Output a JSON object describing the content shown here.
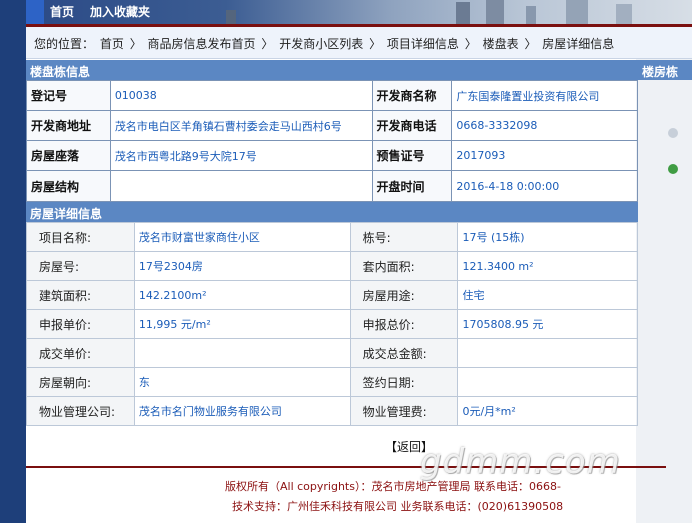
{
  "nav": {
    "home": "首页",
    "favorite": "加入收藏夹"
  },
  "breadcrumb": {
    "prefix": "您的位置：",
    "items": [
      "首页",
      "商品房信息发布首页",
      "开发商小区列表",
      "项目详细信息",
      "楼盘表",
      "房屋详细信息"
    ],
    "separator": "〉"
  },
  "building_info": {
    "header": "楼盘栋信息",
    "side_header": "楼房栋",
    "rows": [
      {
        "l1": "登记号",
        "v1": "010038",
        "l2": "开发商名称",
        "v2": "广东国泰隆置业投资有限公司"
      },
      {
        "l1": "开发商地址",
        "v1": "茂名市电白区羊角镇石曹村委会走马山西村6号",
        "l2": "开发商电话",
        "v2": "0668-3332098"
      },
      {
        "l1": "房屋座落",
        "v1": "茂名市西粤北路9号大院17号",
        "l2": "预售证号",
        "v2": "2017093"
      },
      {
        "l1": "房屋结构",
        "v1": "",
        "l2": "开盘时间",
        "v2": "2016-4-18 0:00:00"
      }
    ]
  },
  "house_detail": {
    "header": "房屋详细信息",
    "rows": [
      {
        "l1": "项目名称:",
        "v1": "茂名市财富世家商住小区",
        "l2": "栋号:",
        "v2": "17号 (15栋)"
      },
      {
        "l1": "房屋号:",
        "v1": "17号2304房",
        "l2": "套内面积:",
        "v2": "121.3400 m²"
      },
      {
        "l1": "建筑面积:",
        "v1": "142.2100m²",
        "l2": "房屋用途:",
        "v2": "住宅"
      },
      {
        "l1": "申报单价:",
        "v1": "11,995 元/m²",
        "l2": "申报总价:",
        "v2": "1705808.95 元"
      },
      {
        "l1": "成交单价:",
        "v1": "",
        "l2": "成交总金额:",
        "v2": ""
      },
      {
        "l1": "房屋朝向:",
        "v1": "东",
        "l2": "签约日期:",
        "v2": ""
      },
      {
        "l1": "物业管理公司:",
        "v1": "茂名市名门物业服务有限公司",
        "l2": "物业管理费:",
        "v2": "0元/月*m²"
      }
    ]
  },
  "back_button": "【返回】",
  "footer": {
    "line1": "版权所有（All copyrights）：茂名市房地产管理局 联系电话：0668-",
    "line2": "技术支持：广州佳禾科技有限公司    业务联系电话：(020)61390508"
  },
  "watermark": "gdmm.com",
  "colors": {
    "header_bg": "#5b87c3",
    "link_text": "#1b5cb8",
    "footer_text": "#8b1010"
  }
}
